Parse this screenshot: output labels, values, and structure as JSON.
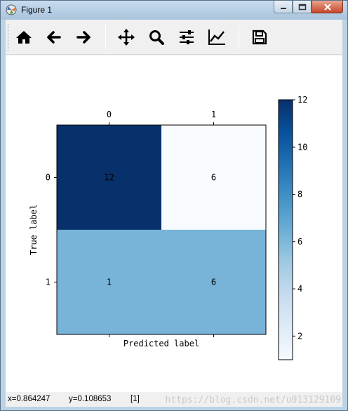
{
  "window": {
    "title": "Figure 1",
    "buttons": [
      "minimize",
      "maximize",
      "close"
    ]
  },
  "toolbar": {
    "items": [
      {
        "name": "home-icon",
        "tooltip": "Home"
      },
      {
        "name": "back-arrow-icon",
        "tooltip": "Back"
      },
      {
        "name": "forward-arrow-icon",
        "tooltip": "Forward"
      },
      {
        "name": "pan-icon",
        "tooltip": "Pan"
      },
      {
        "name": "zoom-icon",
        "tooltip": "Zoom"
      },
      {
        "name": "subplots-icon",
        "tooltip": "Subplots"
      },
      {
        "name": "edit-axes-icon",
        "tooltip": "Customize"
      },
      {
        "name": "save-icon",
        "tooltip": "Save"
      }
    ]
  },
  "status": {
    "x": "x=0.864247",
    "y": "y=0.108653",
    "value": "[1]",
    "watermark": "https://blog.csdn.net/u013129109"
  },
  "chart_data": {
    "type": "heatmap",
    "colormap": "Blues",
    "x_tick_labels": [
      "0",
      "1"
    ],
    "y_tick_labels": [
      "0",
      "1"
    ],
    "xlabel": "Predicted label",
    "ylabel": "True label",
    "x_tick_position": "top",
    "matrix": [
      [
        12,
        6
      ],
      [
        1,
        6
      ]
    ],
    "cell_colors": [
      [
        "#08306b",
        "#f7fbff"
      ],
      [
        "#78b3d8",
        "#78b3d8"
      ]
    ],
    "colorbar": {
      "range": [
        1,
        12
      ],
      "ticks": [
        2,
        4,
        6,
        8,
        10,
        12
      ],
      "tick_labels": [
        "2",
        "4",
        "6",
        "8",
        "10",
        "12"
      ]
    }
  }
}
